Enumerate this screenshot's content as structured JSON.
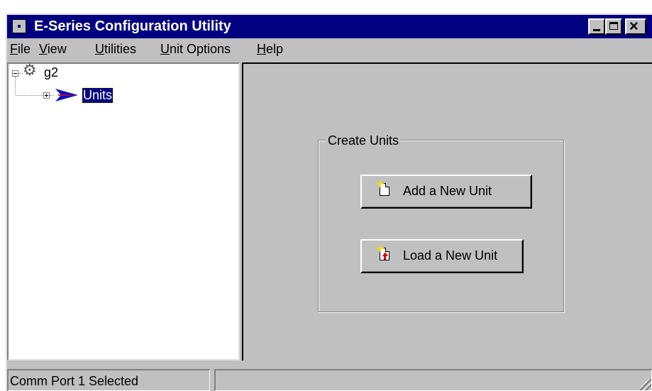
{
  "window": {
    "title": "E-Series Configuration Utility"
  },
  "menu": {
    "items": [
      {
        "label": "File"
      },
      {
        "label": "View"
      },
      {
        "label": "Utilities"
      },
      {
        "label": "Unit Options"
      },
      {
        "label": "Help"
      }
    ]
  },
  "tree": {
    "root": {
      "label": "g2",
      "expanded": true,
      "icon": "gears-icon"
    },
    "children": [
      {
        "label": "Units",
        "expanded": false,
        "selected": true,
        "icon": "arrow-icon"
      }
    ]
  },
  "create_units": {
    "title": "Create Units",
    "add_button": {
      "label": "Add a New Unit",
      "icon": "new-document-icon"
    },
    "load_button": {
      "label": "Load a New Unit",
      "icon": "load-document-icon"
    }
  },
  "statusbar": {
    "text": "Comm Port 1 Selected",
    "second_pane": ""
  },
  "colors": {
    "titlebar": "#000080",
    "face": "#c0c0c0",
    "selection": "#000080"
  }
}
